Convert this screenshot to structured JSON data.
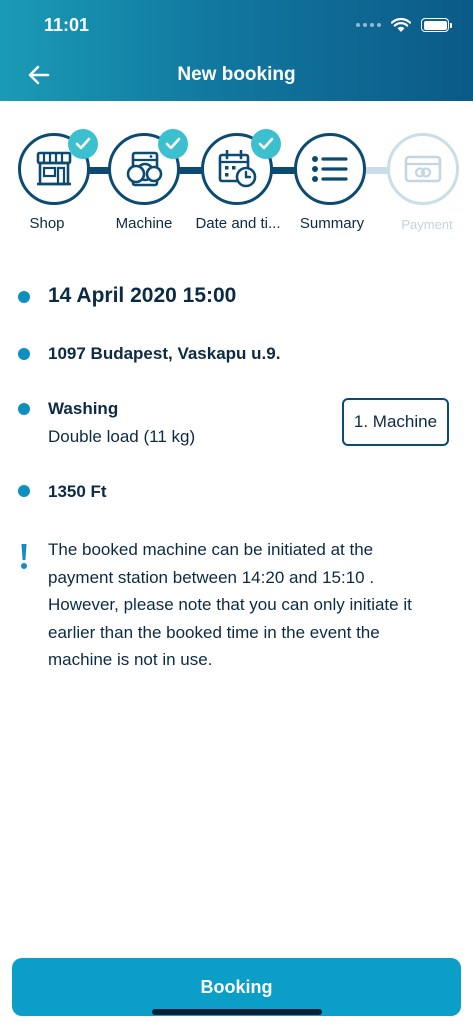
{
  "status_bar": {
    "time": "11:01"
  },
  "header": {
    "title": "New booking"
  },
  "stepper": {
    "steps": [
      {
        "label": "Shop",
        "completed": true
      },
      {
        "label": "Machine",
        "completed": true
      },
      {
        "label": "Date and ti...",
        "completed": true
      },
      {
        "label": "Summary",
        "completed": false
      },
      {
        "label": "Payment",
        "completed": false
      }
    ]
  },
  "summary": {
    "datetime": "14 April 2020 15:00",
    "address": "1097 Budapest, Vaskapu u.9.",
    "program": "Washing",
    "load": "Double load (11 kg)",
    "machine": "1. Machine",
    "price": "1350 Ft",
    "notice": "The booked machine can be initiated at the payment station between 14:20  and 15:10 . However, please note that you can only initiate it earlier than the booked time in the event the machine is not in use."
  },
  "actions": {
    "booking_label": "Booking"
  },
  "colors": {
    "header_start": "#1a9bb6",
    "header_end": "#0b5a88",
    "accent": "#0a9ec9",
    "check": "#3cc0cf",
    "navy": "#0d4a72"
  }
}
